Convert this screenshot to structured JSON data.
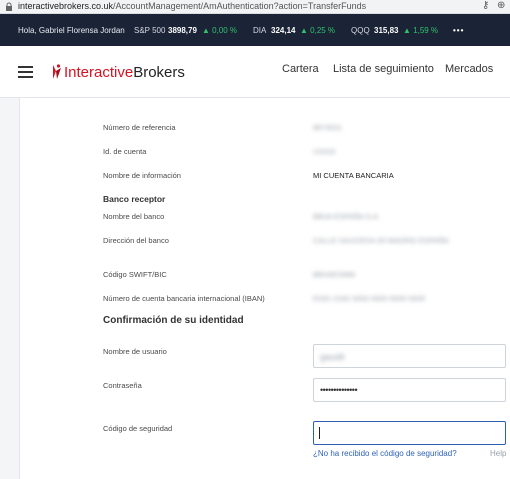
{
  "browser": {
    "url_host": "interactivebrokers.co.uk",
    "url_path": "/AccountManagement/AmAuthentication?action=TransferFunds"
  },
  "ticker": {
    "greeting": "Hola, Gabriel Florensa Jordan",
    "items": [
      {
        "symbol": "S&P 500",
        "value": "3898,79",
        "change": "▲ 0,00 %"
      },
      {
        "symbol": "DIA",
        "value": "324,14",
        "change": "▲ 0,25 %"
      },
      {
        "symbol": "QQQ",
        "value": "315,83",
        "change": "▲ 1,59 %"
      }
    ],
    "more": "•••"
  },
  "header": {
    "logo_part1": "Interactive",
    "logo_part2": "Brokers",
    "nav": [
      "Cartera",
      "Lista de seguimiento",
      "Mercados"
    ]
  },
  "details": {
    "reference_label": "Número de referencia",
    "reference_value": "8874531",
    "account_label": "Id. de cuenta",
    "account_value": "U3318",
    "info_name_label": "Nombre de información",
    "info_name_value": "MI CUENTA BANCARIA"
  },
  "bank": {
    "title": "Banco receptor",
    "name_label": "Nombre del banco",
    "name_value": "BBVA ESPAÑA S.A.",
    "address_label": "Dirección del banco",
    "address_value": "CALLE SAUCEDA 28 MADRID ESPAÑA",
    "swift_label": "Código SWIFT/BIC",
    "swift_value": "BBVAESMM",
    "iban_label": "Número de cuenta bancaria internacional (IBAN)",
    "iban_value": "ES91 0182 0000 0000 0000 0000"
  },
  "identity": {
    "title": "Confirmación de su identidad",
    "username_label": "Nombre de usuario",
    "username_value": "gaudit",
    "password_label": "Contraseña",
    "password_value": "••••••••••••••",
    "code_label": "Código de seguridad",
    "code_value": "",
    "no_code_link": "¿No ha recibido el código de seguridad?",
    "help_link": "Help"
  },
  "colors": {
    "ticker_bg": "#1b2336",
    "ticker_up": "#2fc26b",
    "brand_red": "#d81222",
    "link_blue": "#2f63b8",
    "focus_border": "#2f5fb3"
  }
}
